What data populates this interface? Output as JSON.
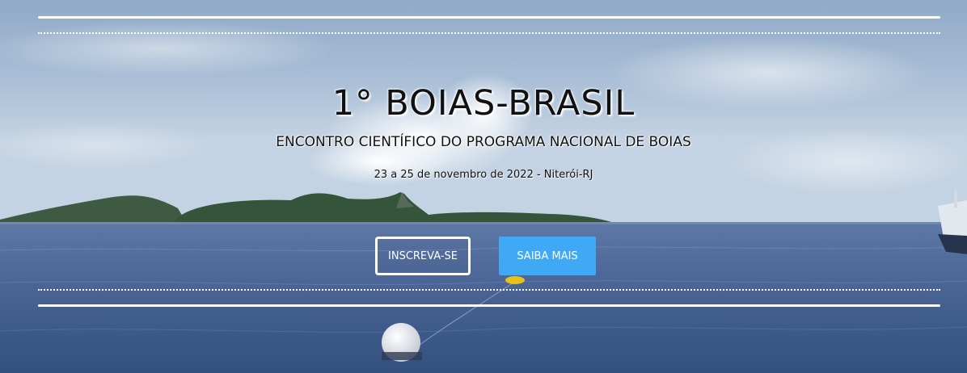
{
  "hero": {
    "title": "1° BOIAS-BRASIL",
    "subtitle": "ENCONTRO CIENTÍFICO DO PROGRAMA NACIONAL DE BOIAS",
    "dateline": "23 a 25 de novembro de 2022 - Niterói-RJ"
  },
  "buttons": {
    "register_label": "INSCREVA-SE",
    "learn_more_label": "SAIBA MAIS"
  },
  "colors": {
    "accent": "#3fa9f5",
    "rule": "#ffffff"
  }
}
